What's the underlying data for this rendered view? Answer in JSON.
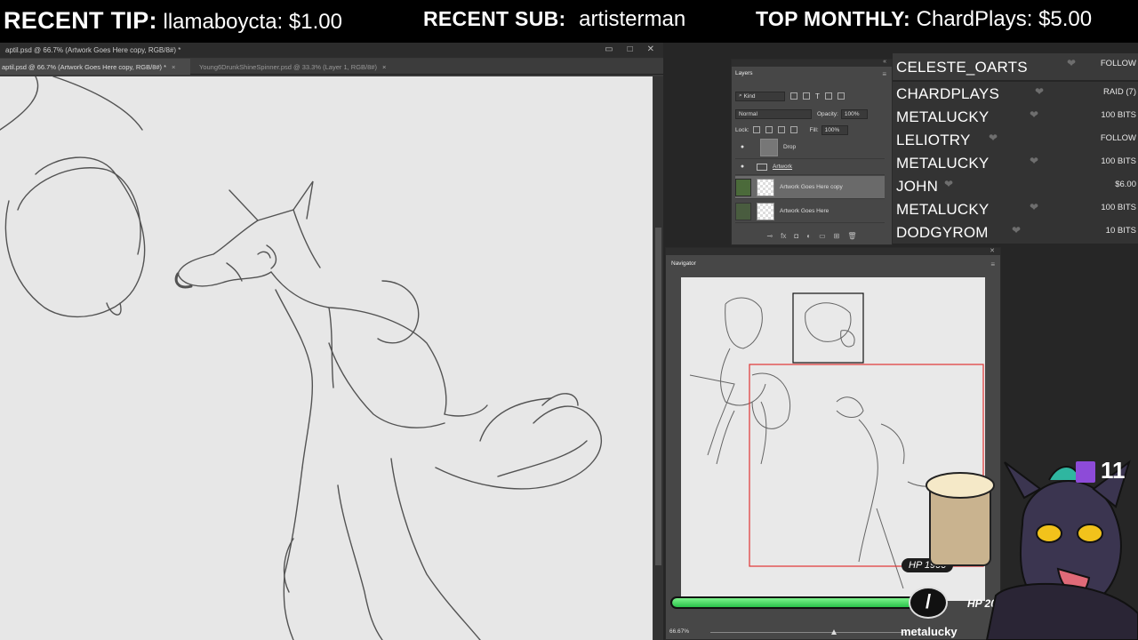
{
  "banner": {
    "tip_label": "RECENT TIP:",
    "tip_value": "llamaboycta: $1.00",
    "sub_label": "RECENT SUB:",
    "sub_value": "artisterman",
    "monthly_label": "TOP MONTHLY:",
    "monthly_value": "ChardPlays: $5.00"
  },
  "photoshop": {
    "window_title": "aptil.psd @ 66.7% (Artwork Goes Here copy, RGB/8#) *",
    "tabs": [
      {
        "label": "aptil.psd @ 66.7% (Artwork Goes Here copy, RGB/8#) *",
        "close": "×"
      },
      {
        "label": "Young6DrunkShineSpinner.psd @ 33.3% (Layer 1, RGB/8#)",
        "close": "×"
      }
    ],
    "window_controls": {
      "minimize": "▭",
      "maximize": "□",
      "close": "✕"
    },
    "status_zoom": "66.67%"
  },
  "layers_panel": {
    "tab": "Layers",
    "filter_label": "Kind",
    "blend_mode": "Normal",
    "opacity_label": "Opacity:",
    "opacity_value": "100%",
    "lock_label": "Lock:",
    "fill_label": "Fill:",
    "fill_value": "100%",
    "layers": [
      {
        "name": "Drop",
        "visible": true,
        "kind": "layer"
      },
      {
        "name": "Artwork",
        "visible": true,
        "kind": "group"
      },
      {
        "name": "Artwork Goes Here copy",
        "visible": true,
        "kind": "layer",
        "selected": true
      },
      {
        "name": "Artwork Goes Here",
        "visible": false,
        "kind": "layer"
      }
    ],
    "footer_icons": [
      "link-icon",
      "fx-icon",
      "mask-icon",
      "adjustment-icon",
      "folder-icon",
      "new-layer-icon",
      "trash-icon"
    ]
  },
  "navigator": {
    "tab": "Navigator",
    "zoom": "66.67%"
  },
  "events": [
    {
      "name": "CELESTE_OARTS",
      "type": "FOLLOW"
    },
    {
      "name": "CHARDPLAYS",
      "type": "RAID (7)"
    },
    {
      "name": "METALUCKY",
      "type": "100 BITS"
    },
    {
      "name": "LELIOTRY",
      "type": "FOLLOW"
    },
    {
      "name": "METALUCKY",
      "type": "100 BITS"
    },
    {
      "name": "JOHN",
      "type": "$6.00"
    },
    {
      "name": "METALUCKY",
      "type": "100 BITS"
    },
    {
      "name": "DODGYROM",
      "type": "10 BITS"
    }
  ],
  "hp": {
    "current_label": "HP 1900",
    "max_label": "HP 2000",
    "fraction": 0.95,
    "username": "metalucky",
    "fill_color": "#2ac24a"
  },
  "viewers": {
    "count": "11",
    "icon": "twitch-icon"
  }
}
